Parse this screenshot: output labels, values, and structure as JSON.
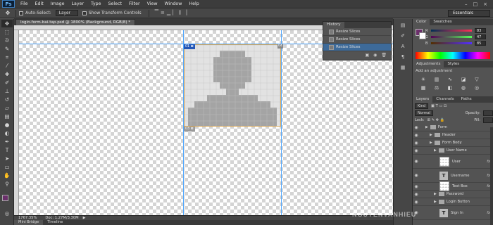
{
  "app": {
    "logo": "Ps"
  },
  "menu": [
    "File",
    "Edit",
    "Image",
    "Layer",
    "Type",
    "Select",
    "Filter",
    "View",
    "Window",
    "Help"
  ],
  "window_controls": [
    "–",
    "□",
    "×"
  ],
  "options_bar": {
    "auto_select_label": "Auto-Select:",
    "auto_select_value": "Layer",
    "transform_label": "Show Transform Controls",
    "workspace": "Essentials"
  },
  "document": {
    "tab_title": "login-form-bai-tap.psd @ 1800% (Background, RGB/8) *",
    "zoom": "1767.35%",
    "doc_size": "Doc: 1.27M/3.30M"
  },
  "slices": {
    "label_a": "01 ⊠",
    "label_b": "03 ⊠",
    "label_c": "04"
  },
  "bottom_tabs": [
    "Mini Bridge",
    "Timeline"
  ],
  "history": {
    "tabs": [
      "History"
    ],
    "rows": [
      {
        "label": "Resize Slices",
        "active": false
      },
      {
        "label": "Resize Slices",
        "active": false
      },
      {
        "label": "Resize Slices",
        "active": true
      }
    ]
  },
  "color_panel": {
    "tabs": [
      "Color",
      "Swatches"
    ],
    "channels": [
      {
        "label": "R",
        "value": "83"
      },
      {
        "label": "G",
        "value": "47"
      },
      {
        "label": "B",
        "value": "85"
      }
    ],
    "fg": "#6b2f6b"
  },
  "adjustments": {
    "tabs": [
      "Adjustments",
      "Styles"
    ],
    "heading": "Add an adjustment"
  },
  "layers": {
    "tabs": [
      "Layers",
      "Channels",
      "Paths"
    ],
    "kind_label": "Kind",
    "blend_mode": "Normal",
    "opacity_label": "Opacity:",
    "lock_label": "Lock:",
    "fill_label": "Fill:",
    "rows": [
      {
        "name": "Form",
        "indent": 8,
        "type": "folder",
        "fx": ""
      },
      {
        "name": "Header",
        "indent": 14,
        "type": "folder",
        "fx": ""
      },
      {
        "name": "Form Body",
        "indent": 14,
        "type": "folder",
        "fx": ""
      },
      {
        "name": "User Name",
        "indent": 20,
        "type": "folder",
        "fx": ""
      },
      {
        "name": "User",
        "indent": 28,
        "type": "image",
        "fx": "fx"
      },
      {
        "name": "Username",
        "indent": 28,
        "type": "text",
        "fx": "fx"
      },
      {
        "name": "Text Box",
        "indent": 28,
        "type": "plain",
        "fx": "fx"
      },
      {
        "name": "Password",
        "indent": 20,
        "type": "folder",
        "fx": ""
      },
      {
        "name": "Login Button",
        "indent": 20,
        "type": "folder",
        "fx": ""
      },
      {
        "name": "Sign In",
        "indent": 28,
        "type": "text",
        "fx": "fx"
      }
    ]
  },
  "watermark": "NGUYENVANHIEU"
}
